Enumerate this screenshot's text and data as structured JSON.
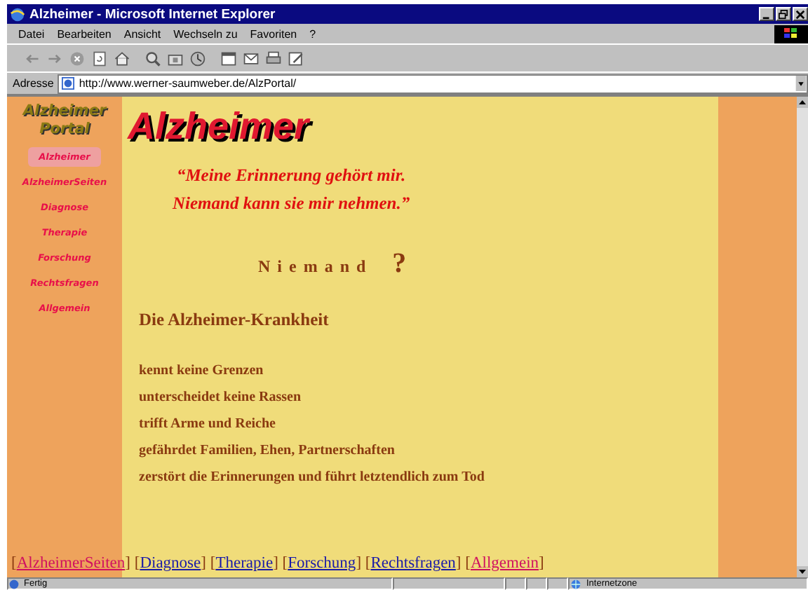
{
  "window": {
    "title": "Alzheimer - Microsoft Internet Explorer"
  },
  "menu": [
    "Datei",
    "Bearbeiten",
    "Ansicht",
    "Wechseln zu",
    "Favoriten",
    "?"
  ],
  "address": {
    "label": "Adresse",
    "value": "http://www.werner-saumweber.de/AlzPortal/"
  },
  "sidebar": {
    "logo": [
      "Alzheimer",
      "Portal"
    ],
    "items": [
      {
        "label": "Alzheimer",
        "selected": true
      },
      {
        "label": "AlzheimerSeiten",
        "selected": false
      },
      {
        "label": "Diagnose",
        "selected": false
      },
      {
        "label": "Therapie",
        "selected": false
      },
      {
        "label": "Forschung",
        "selected": false
      },
      {
        "label": "Rechtsfragen",
        "selected": false
      },
      {
        "label": "Allgemein",
        "selected": false
      }
    ]
  },
  "heading": "Alzheimer",
  "quote": [
    "“Meine Erinnerung gehört mir.",
    "Niemand kann sie mir nehmen.”"
  ],
  "question": {
    "word": "Niemand",
    "mark": "?"
  },
  "subheading": "Die Alzheimer-Krankheit",
  "facts": [
    "kennt keine Grenzen",
    "unterscheidet keine Rassen",
    "trifft Arme und Reiche",
    "gefährdet Familien, Ehen, Partnerschaften",
    "zerstört die Erinnerungen und führt letztendlich zum Tod"
  ],
  "footer_links": [
    {
      "open": "[",
      "label": "AlzheimerSeiten",
      "close": "]",
      "visited": true
    },
    {
      "open": "[",
      "label": "Diagnose",
      "close": "]",
      "visited": false
    },
    {
      "open": "[",
      "label": "Therapie",
      "close": "]",
      "visited": false
    },
    {
      "open": "[",
      "label": "Forschung",
      "close": "]",
      "visited": false
    },
    {
      "open": "[",
      "label": "Rechtsfragen",
      "close": "]",
      "visited": false
    },
    {
      "open": "[",
      "label": "Allgemein",
      "close": "]",
      "visited": true
    }
  ],
  "status_bar": {
    "text": "Fertig",
    "zone": "Internetzone"
  }
}
